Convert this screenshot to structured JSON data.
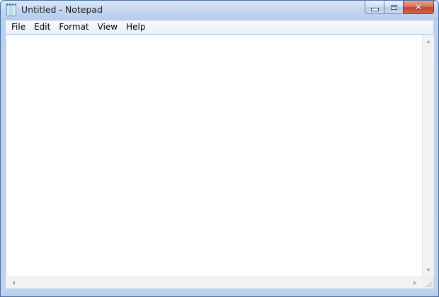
{
  "window": {
    "title": "Untitled - Notepad",
    "icon": "notepad-icon",
    "caption_buttons": {
      "minimize": "minimize-icon",
      "maximize": "maximize-icon",
      "close": "close-icon",
      "close_glyph": "✕"
    }
  },
  "menubar": {
    "items": [
      {
        "label": "File"
      },
      {
        "label": "Edit"
      },
      {
        "label": "Format"
      },
      {
        "label": "View"
      },
      {
        "label": "Help"
      }
    ]
  },
  "editor": {
    "value": ""
  },
  "scrollbars": {
    "vertical": {
      "up": "scroll-up-arrow-icon",
      "down": "scroll-down-arrow-icon"
    },
    "horizontal": {
      "left": "scroll-left-arrow-icon",
      "right": "scroll-right-arrow-icon"
    }
  },
  "colors": {
    "frame": "#bed4ee",
    "close_button": "#c4432a",
    "menubar": "#f0f5fc",
    "editor_background": "#ffffff"
  }
}
